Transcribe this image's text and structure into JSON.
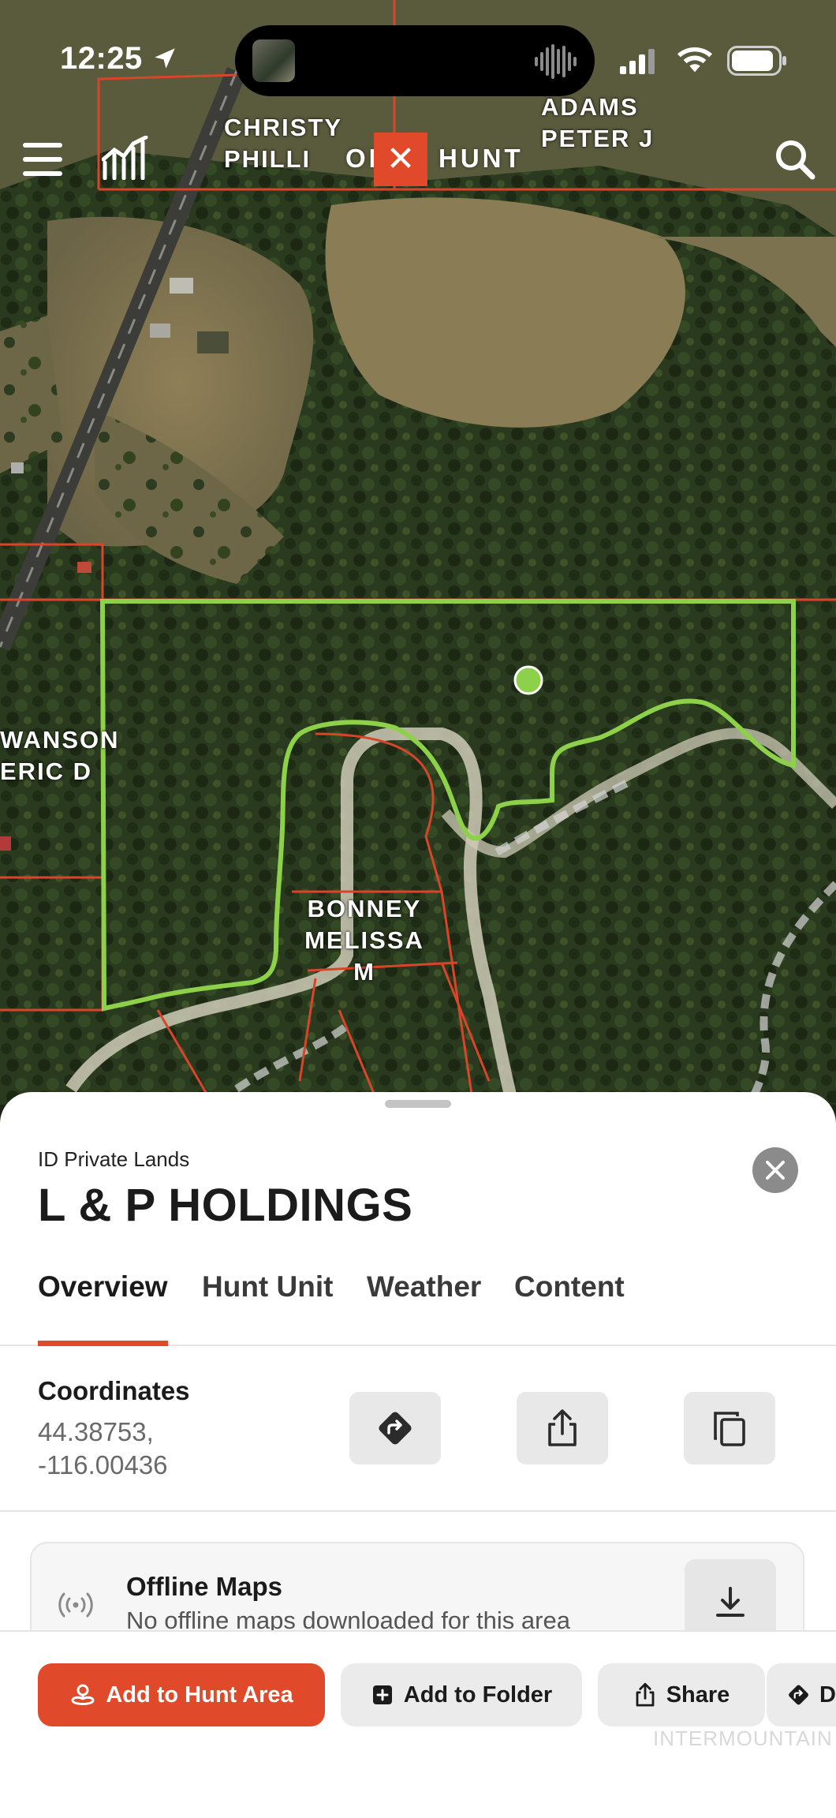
{
  "status_bar": {
    "time": "12:25"
  },
  "brand": {
    "left": "ON",
    "right": "HUNT",
    "accent": "#e0492a",
    "mark": "✕"
  },
  "map": {
    "owner_labels": [
      {
        "id": "christy",
        "text": "CHRISTY\nPHILLI"
      },
      {
        "id": "adams",
        "text": "ADAMS\nPETER J"
      },
      {
        "id": "swanson",
        "text": "WANSON\nERIC D"
      },
      {
        "id": "bonney",
        "text": "BONNEY\nMELISSA\nM"
      }
    ],
    "parcel_outline_color": "#8dd14a",
    "boundary_color": "#d8452a"
  },
  "sheet": {
    "layer": "ID Private Lands",
    "title": "L & P HOLDINGS",
    "tabs": [
      "Overview",
      "Hunt Unit",
      "Weather",
      "Content"
    ],
    "active_tab": "Overview",
    "coordinates": {
      "label": "Coordinates",
      "lat": "44.38753,",
      "lng": "-116.00436"
    },
    "coord_actions": [
      "directions-icon",
      "share-icon",
      "copy-icon"
    ],
    "offline": {
      "title": "Offline Maps",
      "subtitle": "No offline maps downloaded for this area"
    }
  },
  "actions": {
    "add_hunt_area": "Add to Hunt Area",
    "add_folder": "Add to Folder",
    "share": "Share",
    "directions": "D"
  },
  "watermark": "INTERMOUNTAIN"
}
